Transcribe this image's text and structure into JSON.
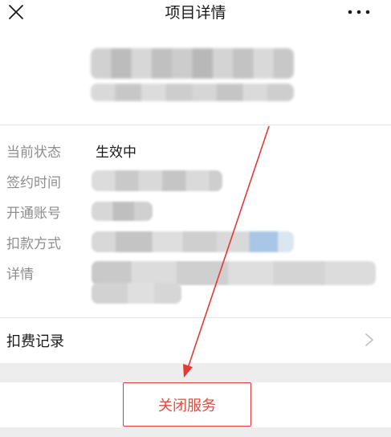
{
  "header": {
    "title": "项目详情",
    "close_icon": "close-icon",
    "more_icon": "more-icon"
  },
  "details": {
    "status_label": "当前状态",
    "status_value": "生效中",
    "sign_time_label": "签约时间",
    "account_label": "开通账号",
    "payment_label": "扣款方式",
    "detail_label": "详情"
  },
  "records": {
    "label": "扣费记录",
    "chevron_icon": "chevron-right-icon"
  },
  "actions": {
    "close_service_label": "关闭服务"
  },
  "colors": {
    "highlight": "#e53935",
    "action_text": "#e8473b",
    "muted_label": "#8e8e8e",
    "band": "#ededed"
  }
}
